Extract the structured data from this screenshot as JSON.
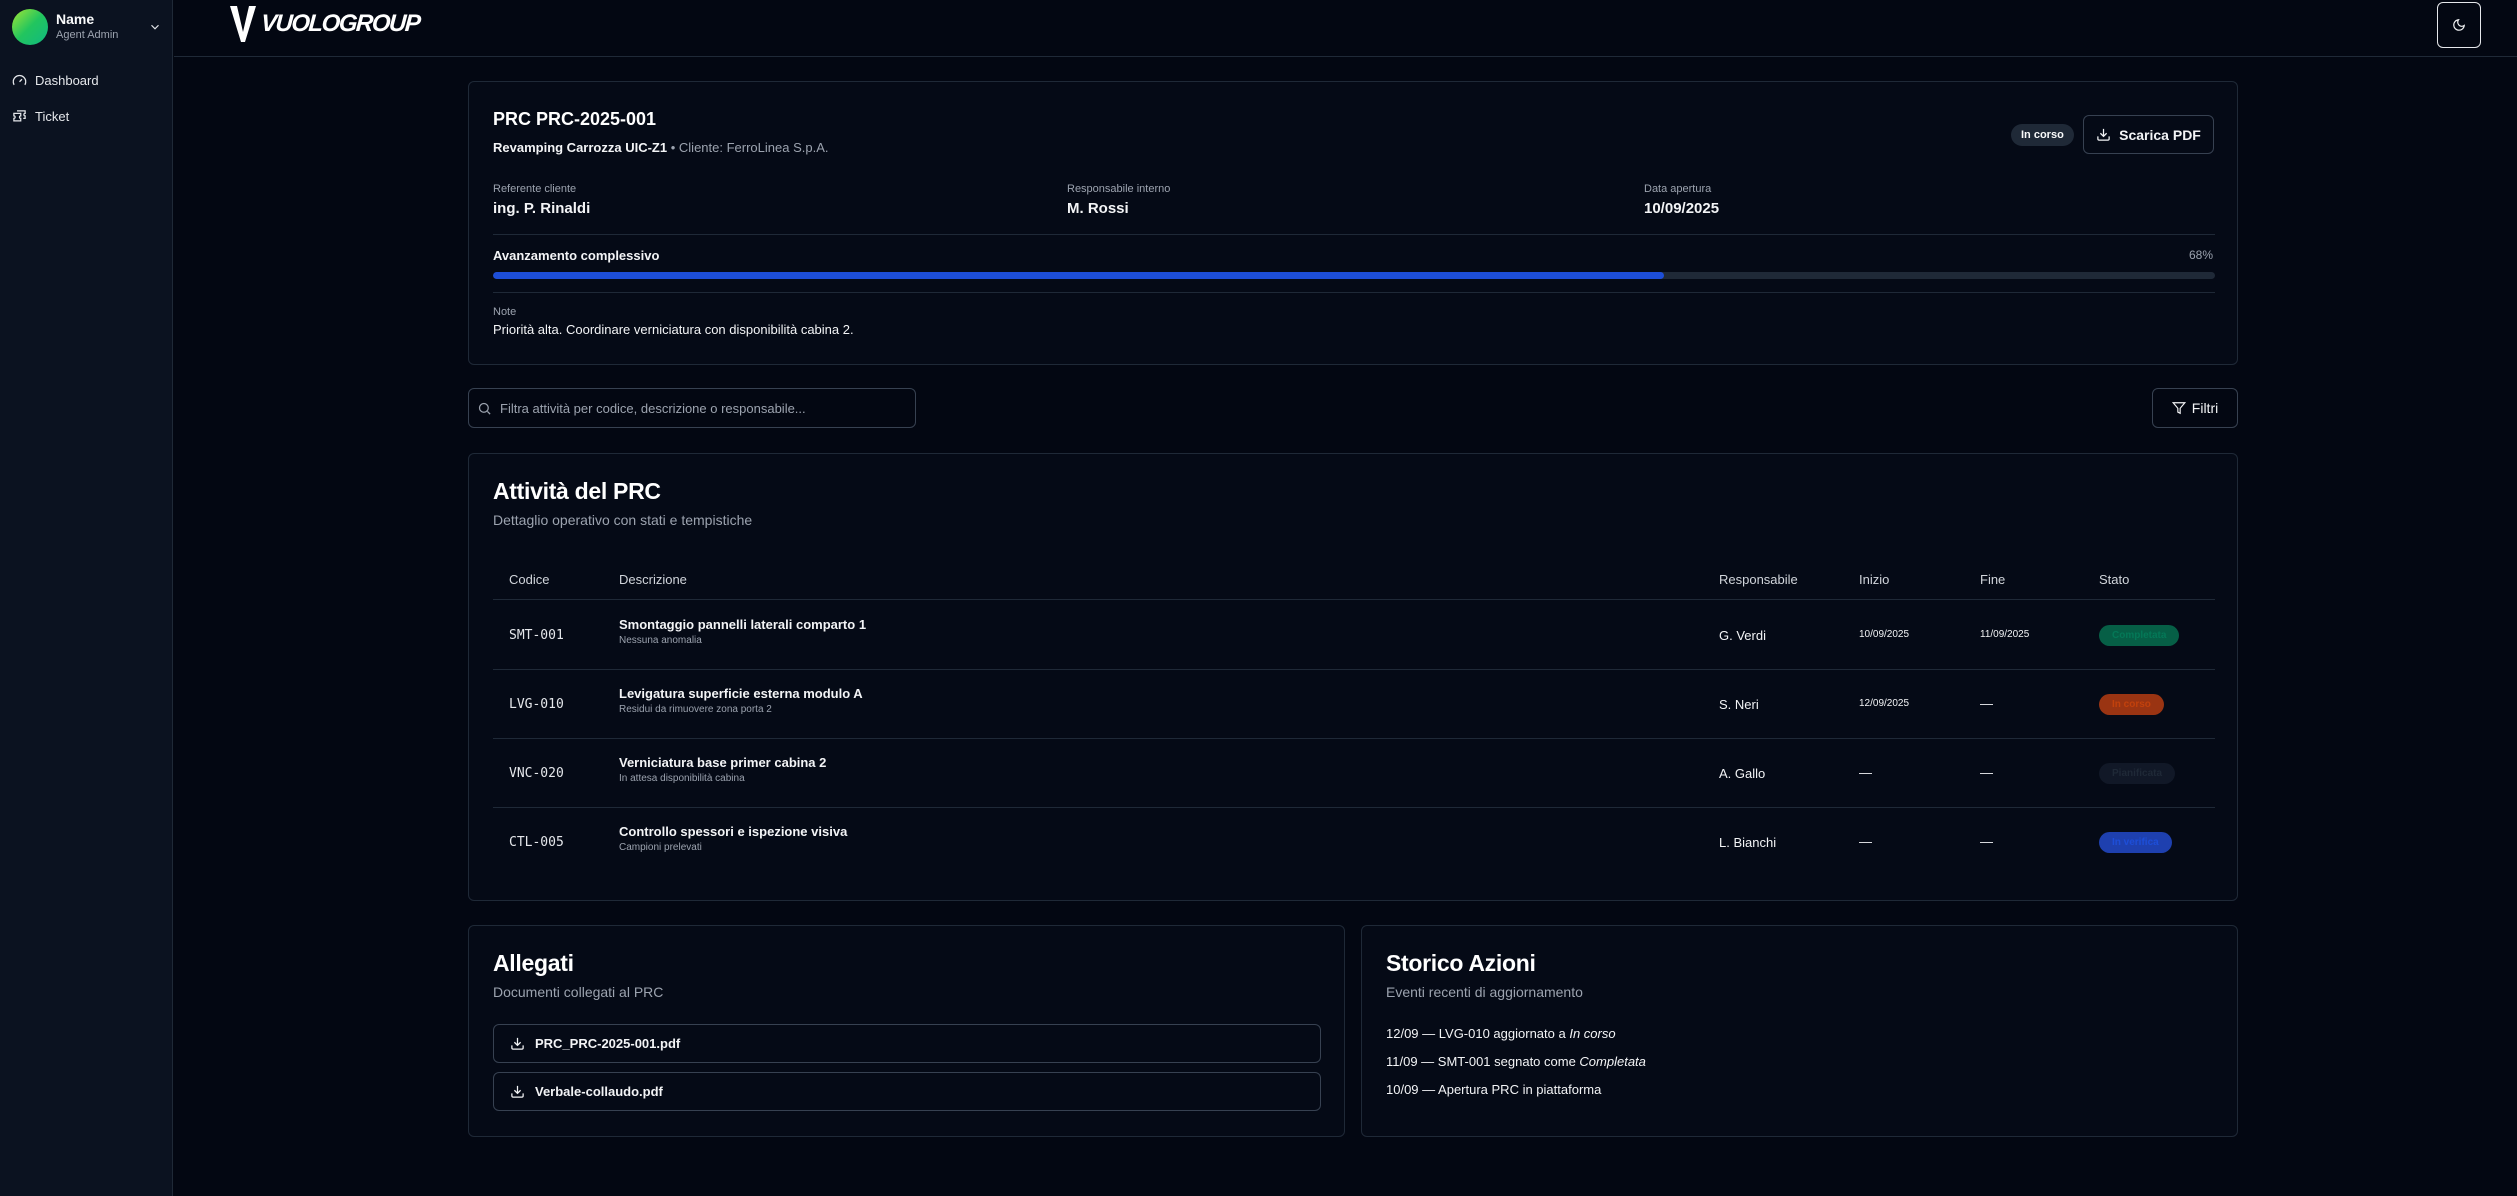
{
  "user": {
    "name": "Name",
    "role": "Agent Admin"
  },
  "sidebar": {
    "items": [
      {
        "label": "Dashboard"
      },
      {
        "label": "Ticket"
      }
    ]
  },
  "header": {
    "logo_text": "VUOLOGROUP"
  },
  "prc": {
    "title": "PRC PRC-2025-001",
    "project": "Revamping Carrozza UIC-Z1",
    "separator": "•",
    "client": "Cliente: FerroLinea S.p.A.",
    "status": "In corso",
    "pdf_label": "Scarica PDF",
    "meta": [
      {
        "label": "Referente cliente",
        "value": "ing. P. Rinaldi"
      },
      {
        "label": "Responsabile interno",
        "value": "M. Rossi"
      },
      {
        "label": "Data apertura",
        "value": "10/09/2025"
      }
    ],
    "progress_label": "Avanzamento complessivo",
    "progress_text": "68%",
    "progress_value": 68,
    "note_label": "Note",
    "note": "Priorità alta. Coordinare verniciatura con disponibilità cabina 2."
  },
  "search": {
    "placeholder": "Filtra attività per codice, descrizione o responsabile..."
  },
  "filters_label": "Filtri",
  "activities": {
    "title": "Attività del PRC",
    "subtitle": "Dettaglio operativo con stati e tempistiche",
    "columns": [
      "Codice",
      "Descrizione",
      "Responsabile",
      "Inizio",
      "Fine",
      "Stato"
    ],
    "rows": [
      {
        "code": "SMT-001",
        "desc": "Smontaggio pannelli laterali comparto 1",
        "sub": "Nessuna anomalia",
        "resp": "G. Verdi",
        "start": "10/09/2025",
        "end": "11/09/2025",
        "status": "Completata"
      },
      {
        "code": "LVG-010",
        "desc": "Levigatura superficie esterna modulo A",
        "sub": "Residui da rimuovere zona porta 2",
        "resp": "S. Neri",
        "start": "12/09/2025",
        "end": "—",
        "status": "In corso"
      },
      {
        "code": "VNC-020",
        "desc": "Verniciatura base primer cabina 2",
        "sub": "In attesa disponibilità cabina",
        "resp": "A. Gallo",
        "start": "—",
        "end": "—",
        "status": "Pianificata"
      },
      {
        "code": "CTL-005",
        "desc": "Controllo spessori e ispezione visiva",
        "sub": "Campioni prelevati",
        "resp": "L. Bianchi",
        "start": "—",
        "end": "—",
        "status": "In verifica"
      }
    ]
  },
  "attachments": {
    "title": "Allegati",
    "subtitle": "Documenti collegati al PRC",
    "files": [
      "PRC_PRC-2025-001.pdf",
      "Verbale-collaudo.pdf"
    ]
  },
  "history": {
    "title": "Storico Azioni",
    "subtitle": "Eventi recenti di aggiornamento",
    "items": [
      {
        "prefix": "12/09 — LVG-010 aggiornato a ",
        "state": "In corso"
      },
      {
        "prefix": "11/09 — SMT-001 segnato come ",
        "state": "Completata"
      },
      {
        "prefix": "10/09 — Apertura PRC in piattaforma",
        "state": ""
      }
    ]
  },
  "colors": {
    "accent": "#1d4ed8",
    "background": "#030712",
    "card": "#050a16"
  }
}
